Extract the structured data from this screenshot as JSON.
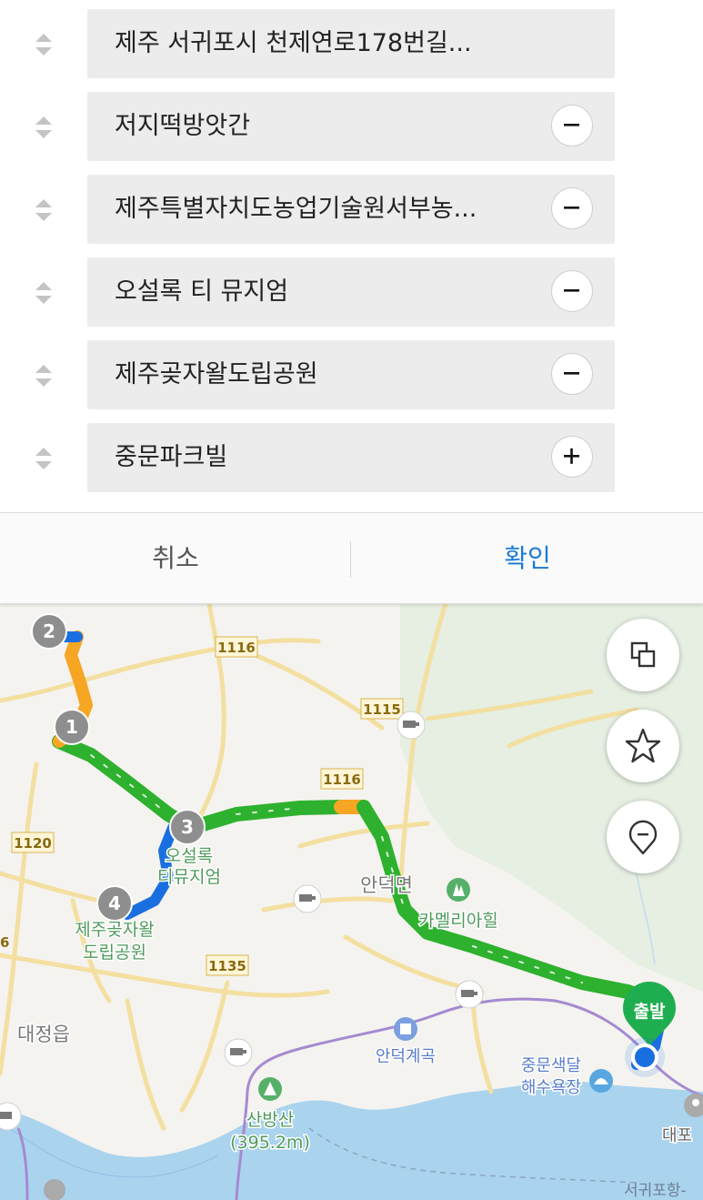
{
  "stops": [
    {
      "label": "제주 서귀포시 천제연로178번길...",
      "action": null
    },
    {
      "label": "저지떡방앗간",
      "action": "remove"
    },
    {
      "label": "제주특별자치도농업기술원서부농...",
      "action": "remove"
    },
    {
      "label": "오설록 티 뮤지엄",
      "action": "remove"
    },
    {
      "label": "제주곶자왈도립공원",
      "action": "remove"
    },
    {
      "label": "중문파크빌",
      "action": "add"
    }
  ],
  "actions": {
    "cancel": "취소",
    "confirm": "확인"
  },
  "map": {
    "road_labels": [
      "1116",
      "1115",
      "1116",
      "1120",
      "1135"
    ],
    "place_labels": {
      "osulloc_1": "오설록",
      "osulloc_2": "티뮤지엄",
      "gotjawal_1": "제주곶자왈",
      "gotjawal_2": "도립공원",
      "andeok": "안덕면",
      "camellia": "카멜리아힐",
      "daejeong": "대정읍",
      "andeok_valley": "안덕계곡",
      "sanbangsan_1": "산방산",
      "sanbangsan_2": "(395.2m)",
      "jungmun_1": "중문색달",
      "jungmun_2": "해수욕장",
      "daepo": "대포",
      "port": "서귀포항-",
      "edge_road": "6"
    },
    "waypoint_badges": [
      "2",
      "1",
      "3",
      "4"
    ],
    "start_label": "출발",
    "controls": [
      "layers-icon",
      "star-icon",
      "location-pin-icon"
    ],
    "route_colors": {
      "green": "#2eb12e",
      "orange": "#f6a623",
      "blue": "#1a6fe0"
    }
  }
}
